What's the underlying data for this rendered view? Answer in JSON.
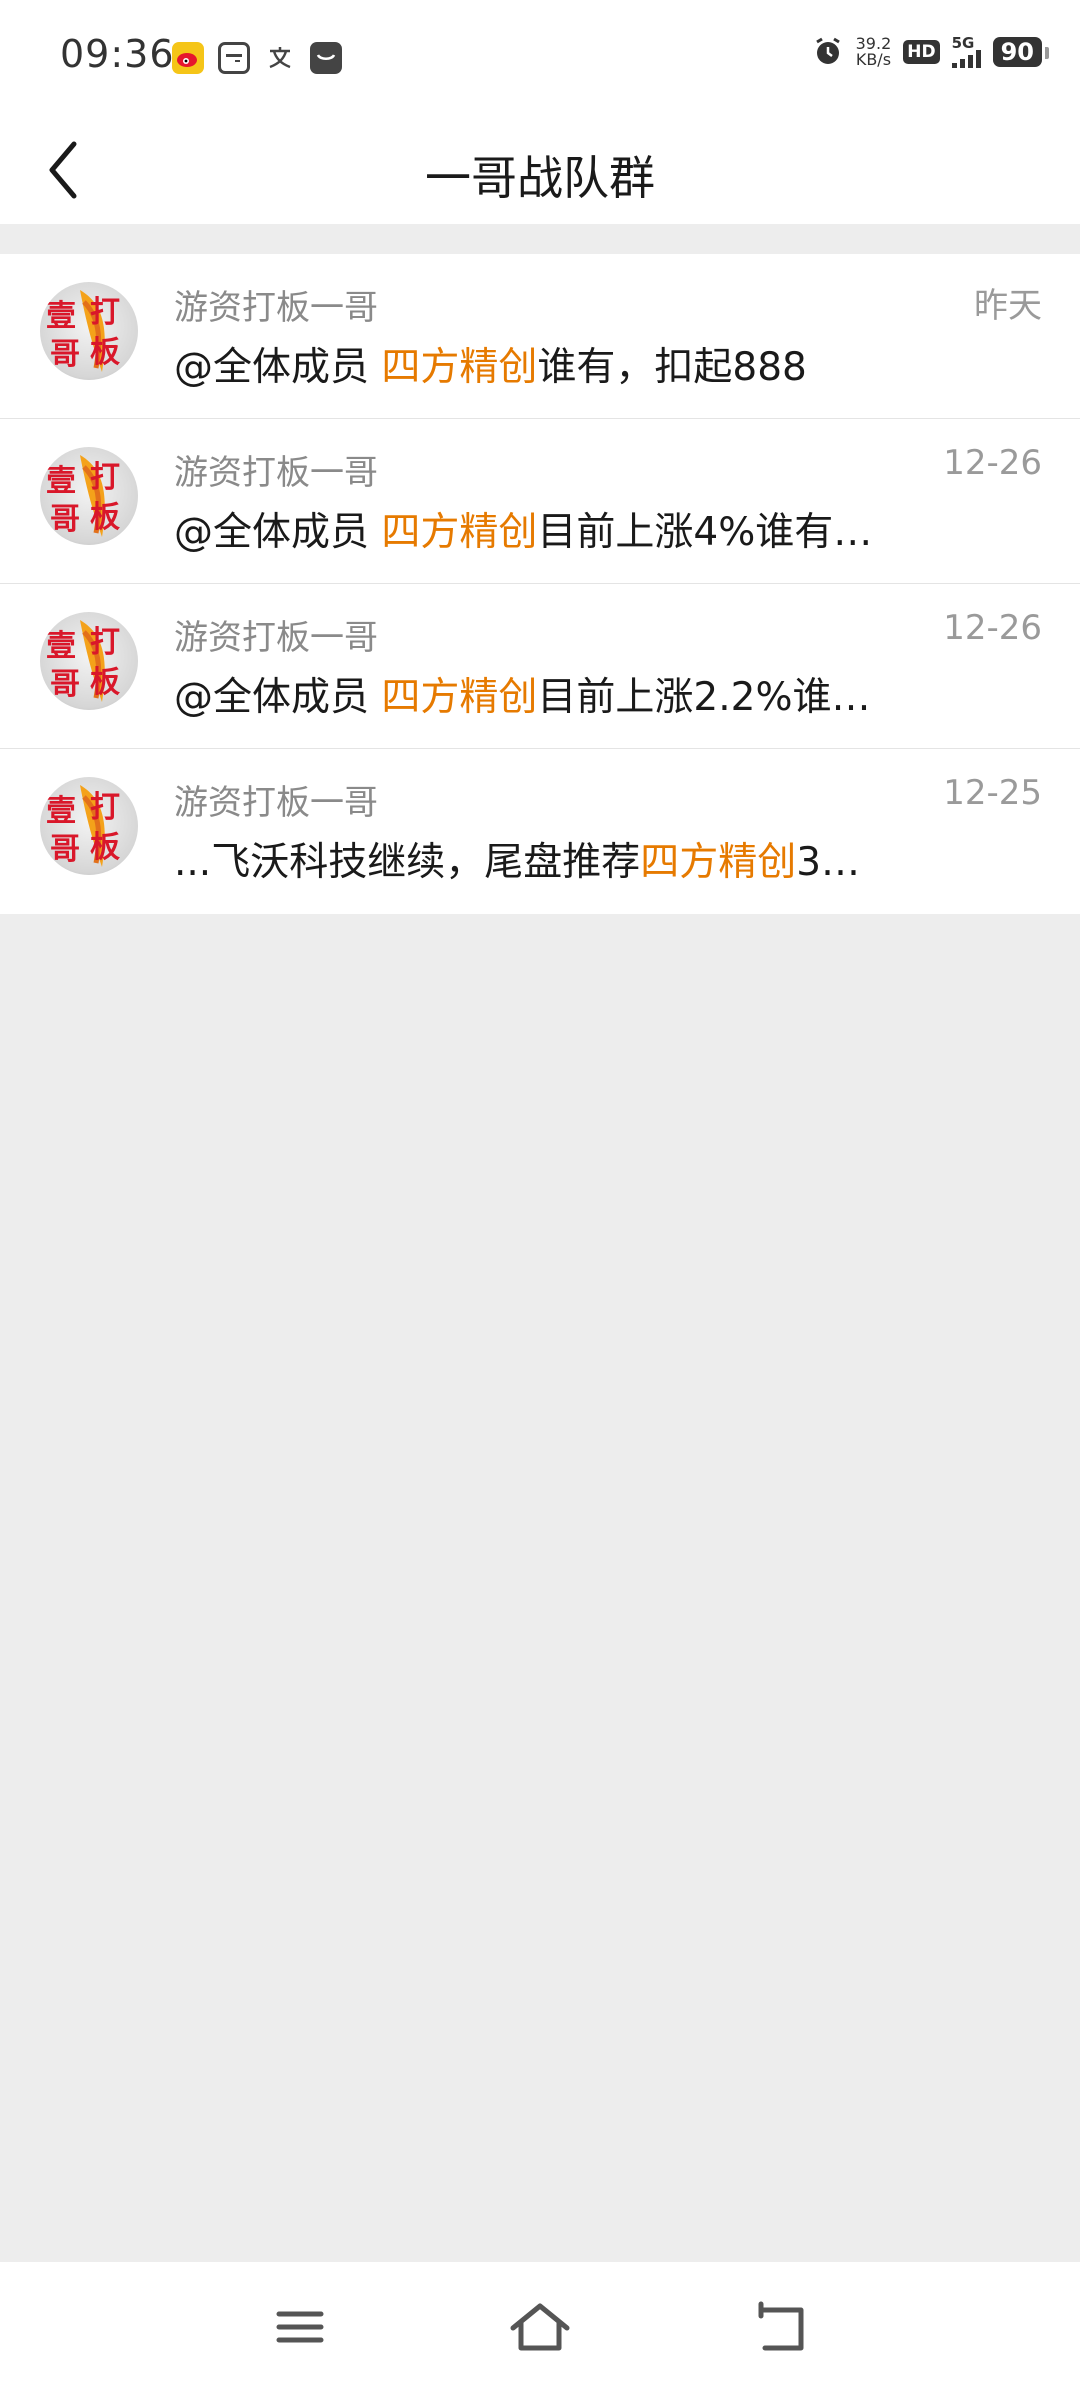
{
  "status_bar": {
    "time": "09:36",
    "net_speed_value": "39.2",
    "net_speed_unit": "KB/s",
    "hd": "HD",
    "network": "5G",
    "battery": "90"
  },
  "header": {
    "title": "一哥战队群"
  },
  "messages": [
    {
      "sender": "游资打板一哥",
      "time": "昨天",
      "prefix": "@全体成员 ",
      "highlight": "四方精创",
      "suffix": "谁有，扣起888"
    },
    {
      "sender": "游资打板一哥",
      "time": "12-26",
      "prefix": "@全体成员 ",
      "highlight": "四方精创",
      "suffix": "目前上涨4%谁有…"
    },
    {
      "sender": "游资打板一哥",
      "time": "12-26",
      "prefix": "@全体成员 ",
      "highlight": "四方精创",
      "suffix": "目前上涨2.2%谁…"
    },
    {
      "sender": "游资打板一哥",
      "time": "12-25",
      "prefix": "...飞沃科技继续，尾盘推荐",
      "highlight": "四方精创",
      "suffix": "3…"
    }
  ],
  "avatar_text": "壹打哥板",
  "colors": {
    "highlight": "#e67a00",
    "background": "#ededed"
  }
}
